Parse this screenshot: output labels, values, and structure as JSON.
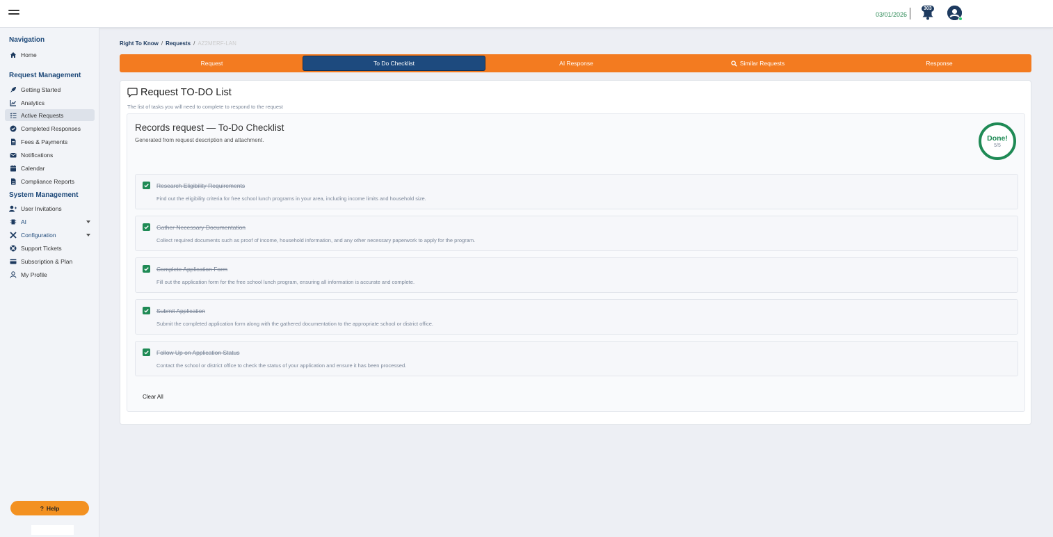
{
  "header": {
    "date": "03/01/2026",
    "notification_count": "303"
  },
  "sidebar": {
    "sections": [
      "Navigation",
      "Request Management",
      "System Management"
    ],
    "items": [
      {
        "label": "Home",
        "icon": "home-icon"
      },
      {
        "label": "Getting Started",
        "icon": "rocket-icon"
      },
      {
        "label": "Analytics",
        "icon": "chart-line-icon"
      },
      {
        "label": "Active Requests",
        "icon": "list-check-icon"
      },
      {
        "label": "Completed Responses",
        "icon": "check-circle-icon"
      },
      {
        "label": "Fees & Payments",
        "icon": "invoice-icon"
      },
      {
        "label": "Notifications",
        "icon": "envelope-icon"
      },
      {
        "label": "Calendar",
        "icon": "calendar-icon"
      },
      {
        "label": "Compliance Reports",
        "icon": "file-icon"
      },
      {
        "label": "User Invitations",
        "icon": "user-plus-icon"
      },
      {
        "label": "AI",
        "icon": "chip-icon"
      },
      {
        "label": "Configuration",
        "icon": "tools-icon"
      },
      {
        "label": "Support Tickets",
        "icon": "lifebuoy-icon"
      },
      {
        "label": "Subscription & Plan",
        "icon": "credit-card-icon"
      },
      {
        "label": "My Profile",
        "icon": "user-icon"
      }
    ],
    "help_label": "Help"
  },
  "breadcrumb": {
    "items": [
      "Right To Know",
      "Requests"
    ],
    "current": "AZ2MERF-LAN"
  },
  "tabs": [
    {
      "label": "Request"
    },
    {
      "label": "To Do Checklist"
    },
    {
      "label": "AI Response"
    },
    {
      "label": "Similar Requests"
    },
    {
      "label": "Response"
    }
  ],
  "card": {
    "title": "Request TO-DO List",
    "subtitle": "The list of tasks you will need to complete to respond to the request",
    "checklist_title": "Records request — To-Do Checklist",
    "checklist_subtitle": "Generated from request description and attachment.",
    "done_label": "Done!",
    "done_count": "5/5",
    "clear_all_label": "Clear All",
    "tasks": [
      {
        "title": "Research Eligibility Requirements",
        "description": "Find out the eligibility criteria for free school lunch programs in your area, including income limits and household size."
      },
      {
        "title": "Gather Necessary Documentation",
        "description": "Collect required documents such as proof of income, household information, and any other necessary paperwork to apply for the program."
      },
      {
        "title": "Complete Application Form",
        "description": "Fill out the application form for the free school lunch program, ensuring all information is accurate and complete."
      },
      {
        "title": "Submit Application",
        "description": "Submit the completed application form along with the gathered documentation to the appropriate school or district office."
      },
      {
        "title": "Follow Up on Application Status",
        "description": "Contact the school or district office to check the status of your application and ensure it has been processed."
      }
    ]
  },
  "colors": {
    "accent_orange": "#f37b20",
    "brand_navy": "#1d3a5f",
    "success_green": "#1f8a55"
  }
}
